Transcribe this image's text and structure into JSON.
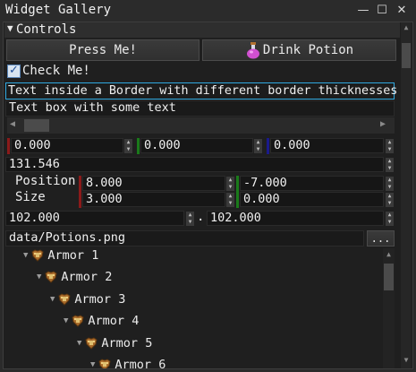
{
  "window": {
    "title": "Widget Gallery",
    "minimize_glyph": "—",
    "maximize_glyph": "☐",
    "close_glyph": "✕"
  },
  "controls_section": {
    "label": "Controls",
    "expand_glyph": "▼"
  },
  "buttons": {
    "press_me": "Press Me!",
    "drink_potion": "Drink Potion"
  },
  "checkbox": {
    "label": "Check Me!",
    "checked": true,
    "check_glyph": "✓"
  },
  "bordered_text": "Text inside a Border with different border thicknesses",
  "text_box": "Text box with some text",
  "hscroll": {
    "left_glyph": "◀",
    "right_glyph": "▶"
  },
  "vector_fields": {
    "x": "0.000",
    "y": "0.000",
    "z": "0.000",
    "colors": {
      "x": "#8b1a1a",
      "y": "#1a7a1a",
      "z": "#1a1a8b"
    }
  },
  "single_value": "131.546",
  "position": {
    "label": "Position",
    "x": "8.000",
    "y": "-7.000"
  },
  "size": {
    "label": "Size",
    "x": "3.000",
    "y": "0.000"
  },
  "range": {
    "min": "102.000",
    "separator": ".",
    "max": "102.000"
  },
  "file": {
    "path": "data/Potions.png",
    "browse_label": "..."
  },
  "tree": [
    {
      "label": "Armor 1",
      "depth": 0
    },
    {
      "label": "Armor 2",
      "depth": 1
    },
    {
      "label": "Armor 3",
      "depth": 2
    },
    {
      "label": "Armor 4",
      "depth": 3
    },
    {
      "label": "Armor 5",
      "depth": 4
    },
    {
      "label": "Armor 6",
      "depth": 5
    }
  ],
  "spin_glyphs": {
    "up": "▲",
    "down": "▼"
  },
  "tree_arrow": "▼"
}
